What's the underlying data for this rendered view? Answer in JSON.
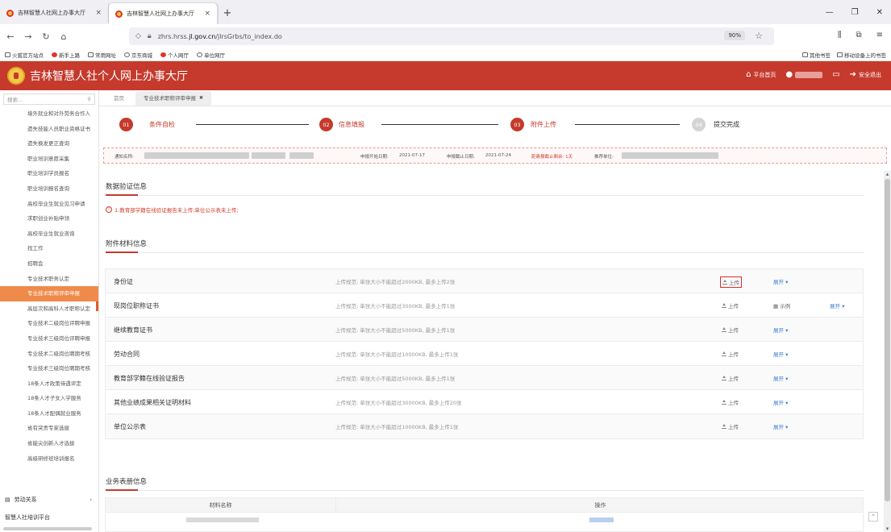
{
  "browser": {
    "tabs": [
      {
        "title": "吉林智慧人社网上办事大厅",
        "close": "×",
        "active": false
      },
      {
        "title": "吉林智慧人社网上办事大厅",
        "close": "×",
        "active": true
      }
    ],
    "new_tab": "+",
    "url_prefix": "zhrs.hrss.",
    "url_domain": "jl.gov.cn",
    "url_path": "/jlrsGrbs/to_index.do",
    "zoom": "90%",
    "bookmarks": [
      "火狐官方站点",
      "新手上路",
      "常用网址",
      "京东商城",
      "个人网厅",
      "单位网厅"
    ],
    "bookmarks_right": [
      "其他书签",
      "移动设备上的书签"
    ]
  },
  "header": {
    "title": "吉林智慧人社个人网上办事大厅",
    "home_link": "平台首页",
    "logout": "安全退出"
  },
  "sidebar": {
    "search_placeholder": "搜索...",
    "items": [
      "境外就业和对外劳务合作人",
      "遗失技能人员职业资格证书",
      "遗失换发更正查询",
      "职业培训意愿采集",
      "职业培训学员报名",
      "职业培训报名查询",
      "高校毕业生就业见习申请",
      "求职创业补贴申领",
      "高校毕业生就业咨询",
      "找工作",
      "招聘会",
      "专业技术职务认定",
      "专业技术职称评审申报",
      "高层次和高科人才职称认定",
      "专业技术二级岗位评聘申报",
      "专业技术三级岗位评聘申报",
      "专业技术二级岗位聘期考核",
      "专业技术三级岗位聘期考核",
      "18条人才政策待遇评定",
      "18条人才子女入学服务",
      "18条人才配偶就业服务",
      "省有突贡专家选拔",
      "省能尖创新人才选拔",
      "高级研修班培训报名"
    ],
    "active_index": 12,
    "group": "劳动关系",
    "bottom": "智慧人社培训平台"
  },
  "breadcrumb": {
    "home": "首页",
    "tab": "专业技术职称评审申报"
  },
  "steps": [
    {
      "num": "01",
      "label": "条件自检",
      "done": true
    },
    {
      "num": "02",
      "label": "信息填报",
      "done": true
    },
    {
      "num": "03",
      "label": "附件上传",
      "done": true
    },
    {
      "num": "04",
      "label": "提交完成",
      "done": false
    }
  ],
  "notice": {
    "name_label": "通知名称:",
    "start_label": "申报开始日期:",
    "start_date": "2021-07-17",
    "end_label": "申报截止日期:",
    "end_date": "2021-07-24",
    "remain": "距离报截止剩余: 1天",
    "unit_label": "推荐单位:"
  },
  "verify": {
    "title": "数据验证信息",
    "message": "1.教育部学籍在线验证报告未上传;单位公示表未上传;"
  },
  "attachments": {
    "title": "附件材料信息",
    "upload_label": "上传",
    "expand_label": "展开",
    "example_label": "示例",
    "rows": [
      {
        "name": "身份证",
        "rule": "上传规范: 单张大小不能超过2000KB, 最多上传2张",
        "example": false,
        "highlight": true
      },
      {
        "name": "现岗位职称证书",
        "rule": "上传规范: 单张大小不能超过3000KB, 最多上传1张",
        "example": true,
        "highlight": false
      },
      {
        "name": "继续教育证书",
        "rule": "上传规范: 单张大小不能超过5000KB, 最多上传1张",
        "example": false,
        "highlight": false
      },
      {
        "name": "劳动合同",
        "rule": "上传规范: 单张大小不能超过10000KB, 最多上传1张",
        "example": false,
        "highlight": false
      },
      {
        "name": "教育部学籍在线验证报告",
        "rule": "上传规范: 单张大小不能超过5000KB, 最多上传1张",
        "example": false,
        "highlight": false
      },
      {
        "name": "其他业绩成果相关证明材料",
        "rule": "上传规范: 单张大小不能超过30000KB, 最多上传20张",
        "example": false,
        "highlight": false
      },
      {
        "name": "单位公示表",
        "rule": "上传规范: 单张大小不能超过10000KB, 最多上传1张",
        "example": false,
        "highlight": false
      }
    ]
  },
  "business": {
    "title": "业务表册信息",
    "col_name": "材料名称",
    "col_op": "操作"
  },
  "colors": {
    "brand_red": "#c53a2d",
    "active_menu": "#f08a4a",
    "link_blue": "#3b7bd6"
  }
}
